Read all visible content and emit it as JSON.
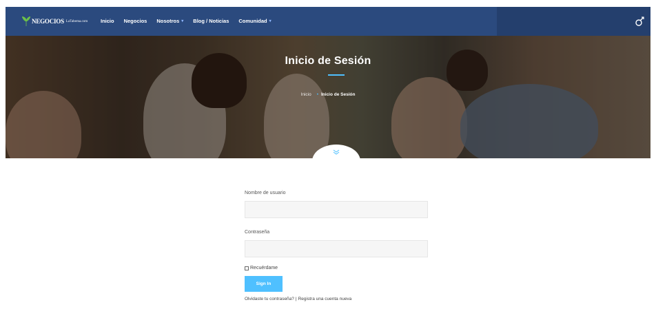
{
  "header": {
    "logo_text": "NEGOCIOS",
    "logo_sub": "LaTaberna.com",
    "nav": [
      {
        "label": "Inicio",
        "dropdown": false
      },
      {
        "label": "Negocios",
        "dropdown": false
      },
      {
        "label": "Nosotros",
        "dropdown": true
      },
      {
        "label": "Blog / Noticias",
        "dropdown": false
      },
      {
        "label": "Comunidad",
        "dropdown": true
      }
    ],
    "right_icon": "theme-toggle-icon"
  },
  "hero": {
    "title": "Inicio de Sesión",
    "breadcrumb_home": "Inicio",
    "breadcrumb_current": "Inicio de Sesión",
    "scroll_icon": "chevron-down-icon"
  },
  "form": {
    "username_label": "Nombre de usuario",
    "username_value": "",
    "password_label": "Contraseña",
    "password_value": "",
    "remember_label": "Recuérdame",
    "signin_label": "Sign In",
    "forgot_link": "Olvidaste tu contraseña?",
    "separator": "|",
    "register_link": "Registra una cuenta nueva"
  },
  "colors": {
    "header_bg": "#2b4a7e",
    "accent": "#4fc0ff"
  }
}
